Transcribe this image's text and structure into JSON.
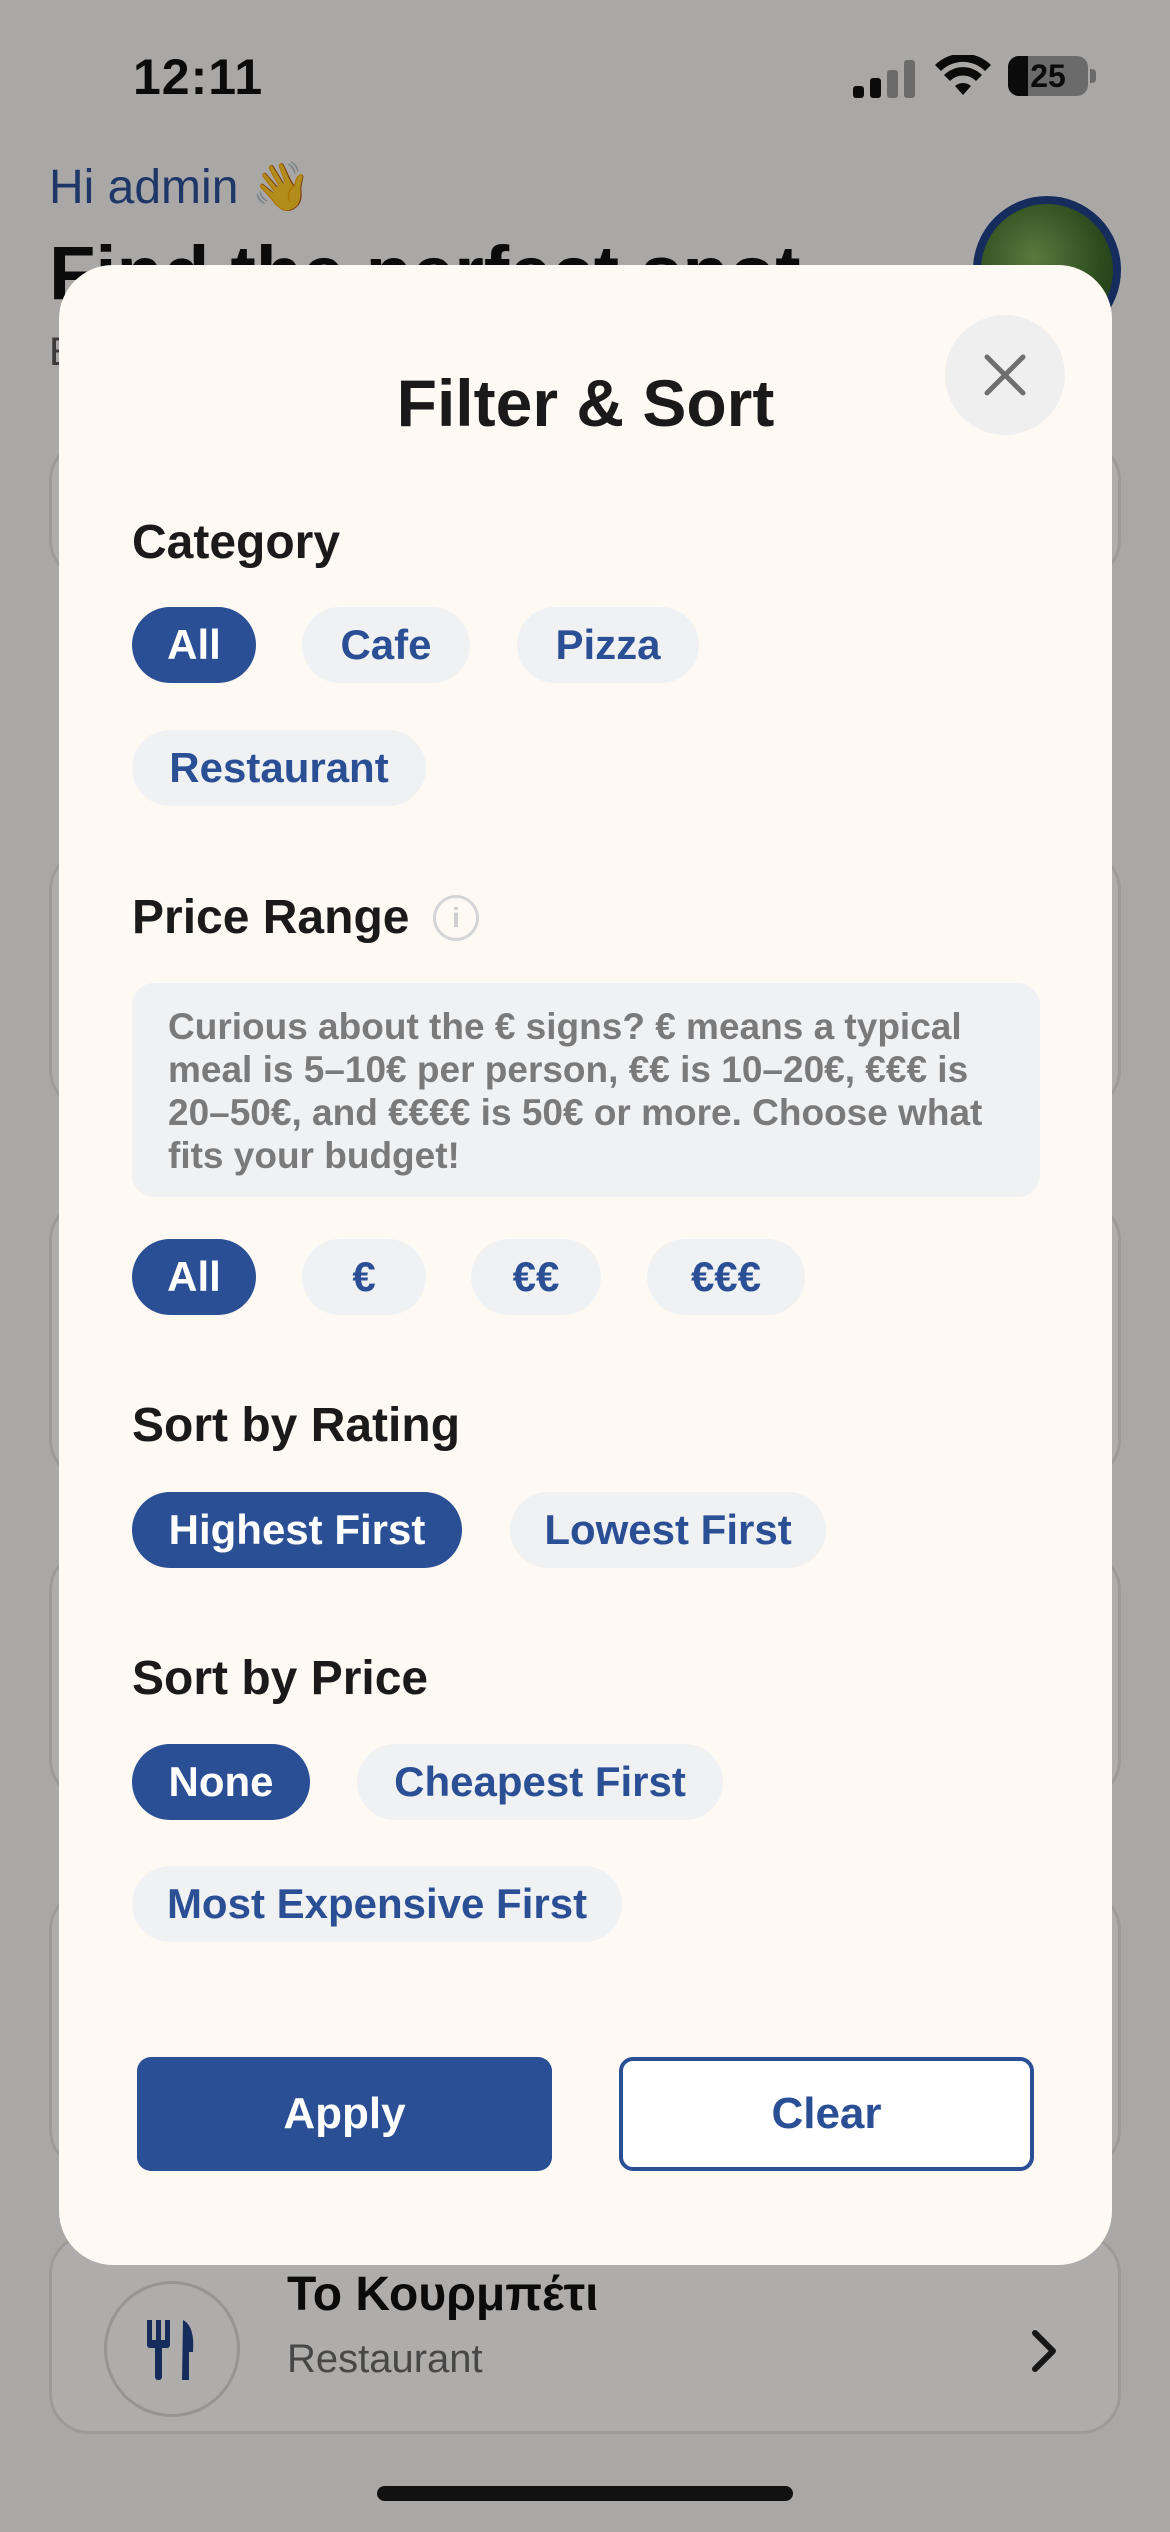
{
  "status_bar": {
    "time": "12:11",
    "battery": "25"
  },
  "background": {
    "greeting": "Hi admin 👋",
    "title": "Find the perfect spot",
    "subtitle": "E",
    "venue": {
      "name": "Το Κουρμπέτι",
      "type": "Restaurant"
    }
  },
  "modal": {
    "title": "Filter & Sort",
    "category": {
      "label": "Category",
      "options": [
        "All",
        "Cafe",
        "Pizza",
        "Restaurant"
      ],
      "selected": "All"
    },
    "price_range": {
      "label": "Price Range",
      "info_icon": "info-icon",
      "info_text": "Curious about the € signs? € means a typical meal is 5–10€ per person, €€ is 10–20€, €€€ is 20–50€, and €€€€ is 50€ or more. Choose what fits your budget!",
      "options": [
        "All",
        "€",
        "€€",
        "€€€"
      ],
      "selected": "All"
    },
    "sort_rating": {
      "label": "Sort by Rating",
      "options": [
        "Highest First",
        "Lowest First"
      ],
      "selected": "Highest First"
    },
    "sort_price": {
      "label": "Sort by Price",
      "options": [
        "None",
        "Cheapest First",
        "Most Expensive First"
      ],
      "selected": "None"
    },
    "apply_label": "Apply",
    "clear_label": "Clear"
  },
  "colors": {
    "accent": "#2b4f95",
    "modal_bg": "#fff9f3",
    "chip_bg": "#f0f1f3"
  }
}
